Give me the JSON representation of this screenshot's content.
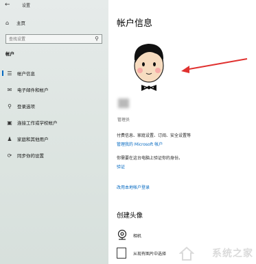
{
  "window": {
    "title": "设置"
  },
  "sidebar": {
    "home_label": "主页",
    "search": {
      "value": "",
      "placeholder": "查找设置"
    },
    "section_title": "帐户",
    "items": [
      {
        "label": "帐户信息",
        "icon": "account-info-icon",
        "active": true
      },
      {
        "label": "电子邮件和帐户",
        "icon": "mail-icon",
        "active": false
      },
      {
        "label": "登录选项",
        "icon": "key-icon",
        "active": false
      },
      {
        "label": "连接工作或学校帐户",
        "icon": "briefcase-icon",
        "active": false
      },
      {
        "label": "家庭和其他用户",
        "icon": "person-add-icon",
        "active": false
      },
      {
        "label": "同步你的设置",
        "icon": "sync-icon",
        "active": false
      }
    ]
  },
  "main": {
    "page_title": "帐户信息",
    "role": "管理员",
    "info_text": "付费信息、家庭设置、订阅、安全设置等",
    "manage_link": "管理我的 Microsoft 帐户",
    "verify_text": "你需要在这台电脑上验证你的身份。",
    "verify_link": "验证",
    "local_link": "改用本地帐户登录",
    "create_avatar_title": "创建头像",
    "camera_label": "相机",
    "browse_label": "从现有图片中选择"
  },
  "colors": {
    "accent": "#0067c0",
    "sidebar_bg": "#e2e8e5"
  },
  "watermark": {
    "text": "系统之家"
  }
}
